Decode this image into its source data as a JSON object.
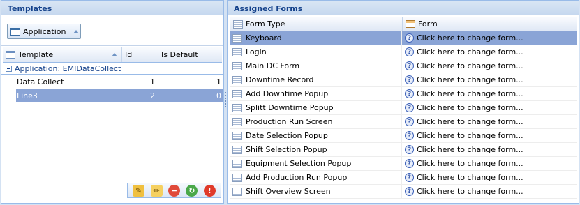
{
  "templates_panel": {
    "title": "Templates",
    "app_button_label": "Application",
    "columns": [
      "Template",
      "Id",
      "Is Default"
    ],
    "group_label": "Application: EMIDataCollect",
    "rows": [
      {
        "template": "Data Collect",
        "id": "1",
        "is_default": "1",
        "selected": false
      },
      {
        "template": "Line3",
        "id": "2",
        "is_default": "0",
        "selected": true
      }
    ],
    "tools": [
      "edit-add-icon",
      "pencil-icon",
      "remove-icon",
      "refresh-icon",
      "alert-icon"
    ]
  },
  "forms_panel": {
    "title": "Assigned Forms",
    "columns": [
      "Form Type",
      "Form"
    ],
    "rows": [
      {
        "type": "Keyboard",
        "form": "Click here to change form...",
        "selected": true
      },
      {
        "type": "Login",
        "form": "Click here to change form..."
      },
      {
        "type": "Main DC Form",
        "form": "Click here to change form..."
      },
      {
        "type": "Downtime Record",
        "form": "Click here to change form..."
      },
      {
        "type": "Add Downtime Popup",
        "form": "Click here to change form..."
      },
      {
        "type": "Splitt Downtime Popup",
        "form": "Click here to change form..."
      },
      {
        "type": "Production Run Screen",
        "form": "Click here to change form..."
      },
      {
        "type": "Date Selection Popup",
        "form": "Click here to change form..."
      },
      {
        "type": "Shift Selection Popup",
        "form": "Click here to change form..."
      },
      {
        "type": "Equipment Selection Popup",
        "form": "Click here to change form..."
      },
      {
        "type": "Add Production Run Popup",
        "form": "Click here to change form..."
      },
      {
        "type": "Shift Overview Screen",
        "form": "Click here to change form..."
      }
    ]
  },
  "colors": {
    "header_text": "#15428b",
    "selection": "#8aa4d6",
    "border": "#99bbe8"
  }
}
